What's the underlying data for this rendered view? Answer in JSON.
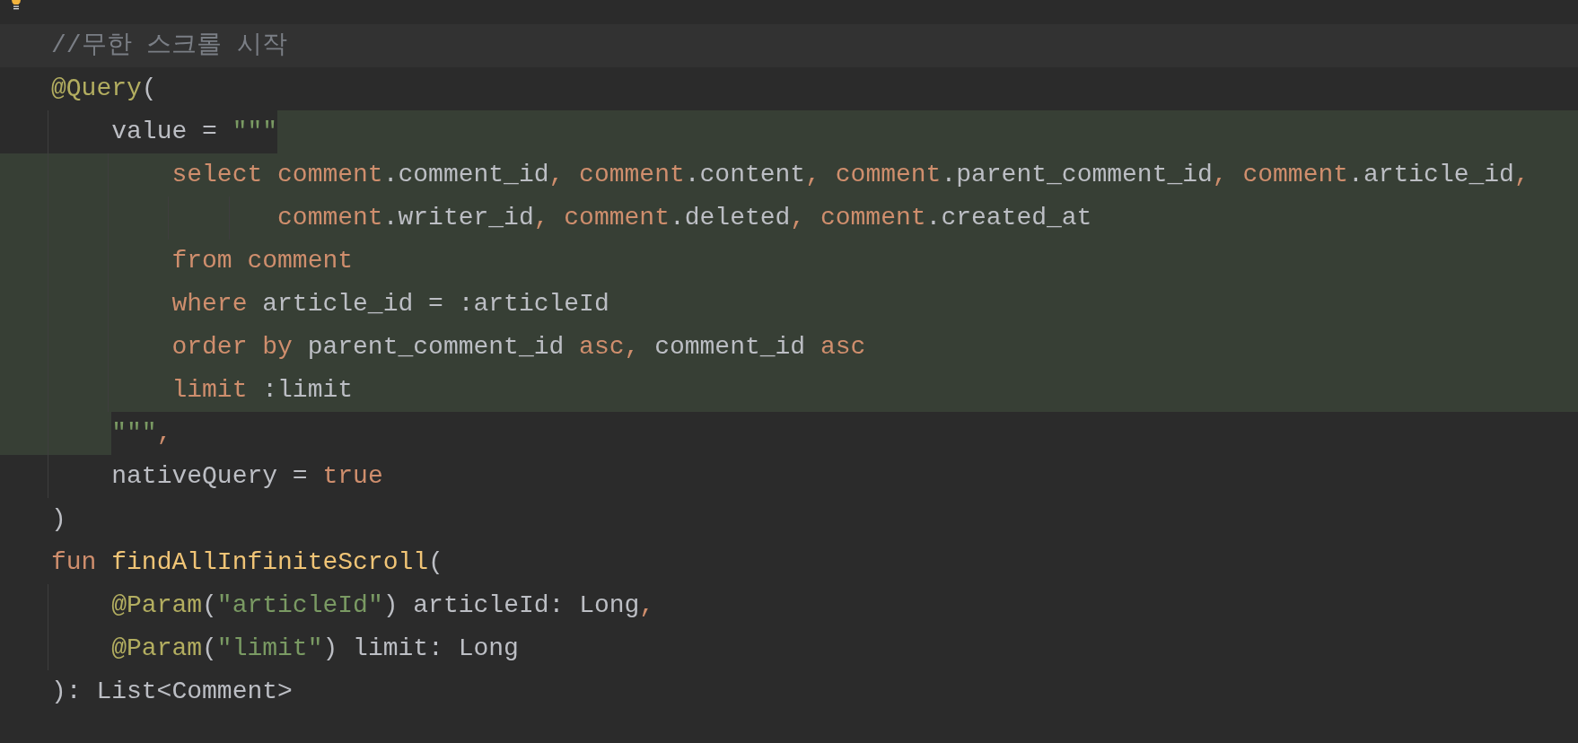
{
  "lines": [
    {
      "kind": "current",
      "tokens": [
        {
          "kind": "comment",
          "text": "//무한 스크롤 시작"
        }
      ]
    },
    {
      "kind": "plain",
      "tokens": [
        {
          "kind": "annotation",
          "text": "@Query"
        },
        {
          "kind": "plain",
          "text": "("
        }
      ]
    },
    {
      "kind": "injected_start",
      "tokens": [
        {
          "kind": "plain",
          "text": "    value = "
        },
        {
          "kind": "string",
          "text": "\"\"\""
        }
      ]
    },
    {
      "kind": "injected",
      "tokens": [
        {
          "kind": "keyword",
          "text": "        select comment"
        },
        {
          "kind": "plain",
          "text": ".comment_id"
        },
        {
          "kind": "keyword",
          "text": ", comment"
        },
        {
          "kind": "plain",
          "text": ".content"
        },
        {
          "kind": "keyword",
          "text": ", comment"
        },
        {
          "kind": "plain",
          "text": ".parent_comment_id"
        },
        {
          "kind": "keyword",
          "text": ", comment"
        },
        {
          "kind": "plain",
          "text": ".article_id"
        },
        {
          "kind": "keyword",
          "text": ","
        }
      ]
    },
    {
      "kind": "injected",
      "tokens": [
        {
          "kind": "keyword",
          "text": "               comment"
        },
        {
          "kind": "plain",
          "text": ".writer_id"
        },
        {
          "kind": "keyword",
          "text": ", comment"
        },
        {
          "kind": "plain",
          "text": ".deleted"
        },
        {
          "kind": "keyword",
          "text": ", comment"
        },
        {
          "kind": "plain",
          "text": ".created_at"
        }
      ]
    },
    {
      "kind": "injected",
      "tokens": [
        {
          "kind": "keyword",
          "text": "        from comment"
        }
      ]
    },
    {
      "kind": "injected",
      "tokens": [
        {
          "kind": "keyword",
          "text": "        where "
        },
        {
          "kind": "plain",
          "text": "article_id = :articleId"
        }
      ]
    },
    {
      "kind": "injected",
      "tokens": [
        {
          "kind": "keyword",
          "text": "        order by "
        },
        {
          "kind": "plain",
          "text": "parent_comment_id "
        },
        {
          "kind": "keyword",
          "text": "asc, "
        },
        {
          "kind": "plain",
          "text": "comment_id "
        },
        {
          "kind": "keyword",
          "text": "asc"
        }
      ]
    },
    {
      "kind": "injected",
      "tokens": [
        {
          "kind": "keyword",
          "text": "        limit "
        },
        {
          "kind": "plain",
          "text": ":limit"
        }
      ]
    },
    {
      "kind": "injected_end",
      "tokens": [
        {
          "kind": "string",
          "text": "    \"\"\""
        },
        {
          "kind": "keyword",
          "text": ","
        }
      ]
    },
    {
      "kind": "plain",
      "tokens": [
        {
          "kind": "plain",
          "text": "    nativeQuery = "
        },
        {
          "kind": "keyword",
          "text": "true"
        }
      ]
    },
    {
      "kind": "plain",
      "tokens": [
        {
          "kind": "plain",
          "text": ")"
        }
      ]
    },
    {
      "kind": "plain",
      "tokens": [
        {
          "kind": "keyword",
          "text": "fun "
        },
        {
          "kind": "function",
          "text": "findAllInfiniteScroll"
        },
        {
          "kind": "plain",
          "text": "("
        }
      ]
    },
    {
      "kind": "plain",
      "tokens": [
        {
          "kind": "annotation",
          "text": "    @Param"
        },
        {
          "kind": "plain",
          "text": "("
        },
        {
          "kind": "string",
          "text": "\"articleId\""
        },
        {
          "kind": "plain",
          "text": ") articleId: Long"
        },
        {
          "kind": "keyword",
          "text": ","
        }
      ]
    },
    {
      "kind": "plain",
      "tokens": [
        {
          "kind": "annotation",
          "text": "    @Param"
        },
        {
          "kind": "plain",
          "text": "("
        },
        {
          "kind": "string",
          "text": "\"limit\""
        },
        {
          "kind": "plain",
          "text": ") limit: Long"
        }
      ]
    },
    {
      "kind": "plain",
      "tokens": [
        {
          "kind": "plain",
          "text": "): List<Comment>"
        }
      ]
    }
  ]
}
